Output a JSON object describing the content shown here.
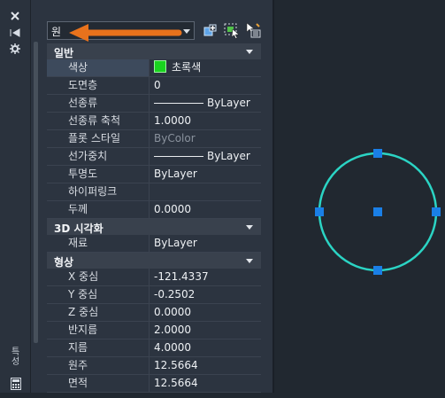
{
  "palette": {
    "selection_type": "원",
    "vertical_title": "특성"
  },
  "categories": [
    {
      "label": "일반",
      "rows": [
        {
          "key": "색상",
          "value": "초록색",
          "swatch": "#19d41f"
        },
        {
          "key": "도면층",
          "value": "0"
        },
        {
          "key": "선종류",
          "value": "ByLayer",
          "line": true
        },
        {
          "key": "선종류 축척",
          "value": "1.0000"
        },
        {
          "key": "플롯 스타일",
          "value": "ByColor",
          "dim": true
        },
        {
          "key": "선가중치",
          "value": "ByLayer",
          "line": true
        },
        {
          "key": "투명도",
          "value": "ByLayer"
        },
        {
          "key": "하이퍼링크",
          "value": ""
        },
        {
          "key": "두께",
          "value": "0.0000"
        }
      ]
    },
    {
      "label": "3D 시각화",
      "rows": [
        {
          "key": "재료",
          "value": "ByLayer"
        }
      ]
    },
    {
      "label": "형상",
      "rows": [
        {
          "key": "X 중심",
          "value": "-121.4337"
        },
        {
          "key": "Y 중심",
          "value": "-0.2502"
        },
        {
          "key": "Z 중심",
          "value": "0.0000"
        },
        {
          "key": "반지름",
          "value": "2.0000"
        },
        {
          "key": "지름",
          "value": "4.0000"
        },
        {
          "key": "원주",
          "value": "12.5664"
        },
        {
          "key": "면적",
          "value": "12.5664"
        }
      ]
    }
  ],
  "colors": {
    "circle_stroke": "#2bd4c4",
    "grip": "#1a7fe6",
    "annotation_arrow": "#e8721c"
  }
}
